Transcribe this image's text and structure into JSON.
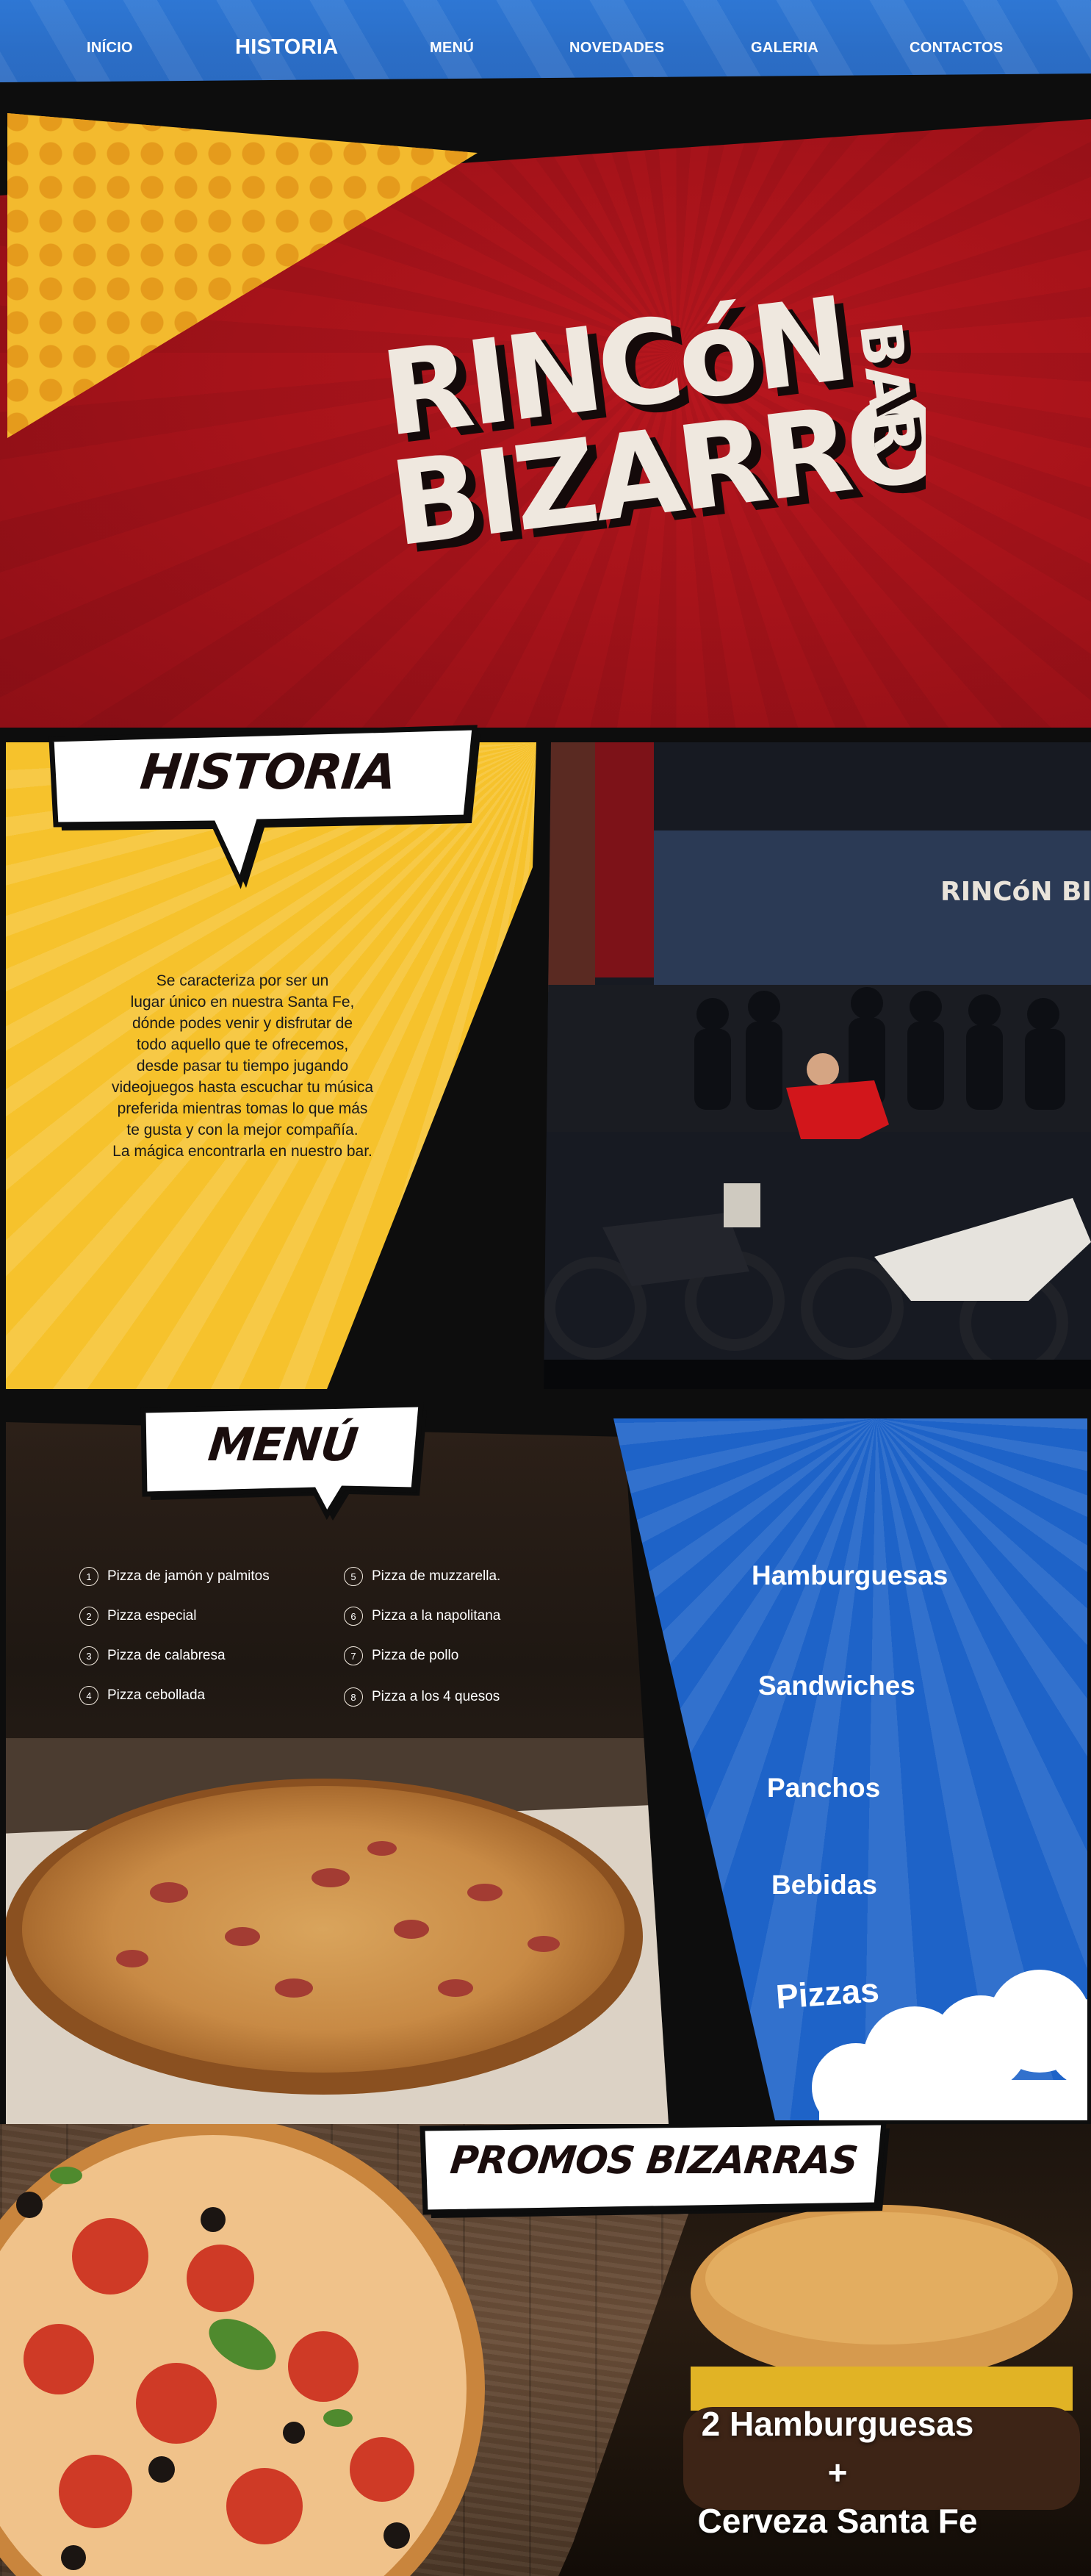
{
  "nav": {
    "items": [
      {
        "label": "INÍCIO"
      },
      {
        "label": "HISTORIA"
      },
      {
        "label": "MENÚ"
      },
      {
        "label": "NOVEDADES"
      },
      {
        "label": "GALERIA"
      },
      {
        "label": "CONTACTOS"
      }
    ],
    "active": "HISTORIA"
  },
  "hero": {
    "logo_line1": "RINCóN",
    "logo_line2": "BIZARRO",
    "logo_side": "BAR"
  },
  "historia": {
    "title": "HISTORIA",
    "text": "Se caracteriza por ser un lugar único en nuestra Santa Fe, dónde podes venir y disfrutar de todo aquello que te ofrecemos, desde pasar tu tiempo jugando videojuegos hasta escuchar tu música preferida mientras tomas lo que más te gusta y con la mejor compañía. La mágica encontrarla en nuestro bar.",
    "lines": [
      "Se caracteriza por ser un",
      "lugar único en nuestra Santa Fe,",
      "dónde podes venir y disfrutar de",
      "todo aquello que te ofrecemos,",
      "desde pasar tu tiempo jugando",
      "videojuegos hasta escuchar tu música",
      "preferida mientras tomas lo que más",
      "te gusta y con la mejor compañía.",
      "La mágica encontrarla en nuestro bar."
    ],
    "photo_sign": "RINCóN BIZARRO"
  },
  "menu": {
    "title": "MENÚ",
    "pizzas": [
      {
        "num": "1",
        "name": "Pizza de jamón y palmitos"
      },
      {
        "num": "2",
        "name": "Pizza especial"
      },
      {
        "num": "3",
        "name": "Pizza de calabresa"
      },
      {
        "num": "4",
        "name": "Pizza cebollada"
      },
      {
        "num": "5",
        "name": "Pizza de muzzarella."
      },
      {
        "num": "6",
        "name": "Pizza a la napolitana"
      },
      {
        "num": "7",
        "name": "Pizza de pollo"
      },
      {
        "num": "8",
        "name": "Pizza  a los 4 quesos"
      }
    ],
    "categories": [
      {
        "label": "Hamburguesas"
      },
      {
        "label": "Sandwiches"
      },
      {
        "label": "Panchos"
      },
      {
        "label": "Bebidas"
      },
      {
        "label": "Pizzas"
      }
    ]
  },
  "promos": {
    "title": "PROMOS BIZARRAS",
    "lines": [
      "2 Hamburguesas",
      "+",
      "Cerveza Santa Fe"
    ]
  },
  "colors": {
    "nav_blue": "#2b6ec7",
    "hero_red": "#a7131a",
    "comic_yellow": "#f6c22c",
    "menu_blue": "#1e63c8",
    "logo_cream": "#efe8df",
    "border_black": "#0d0d0d"
  }
}
